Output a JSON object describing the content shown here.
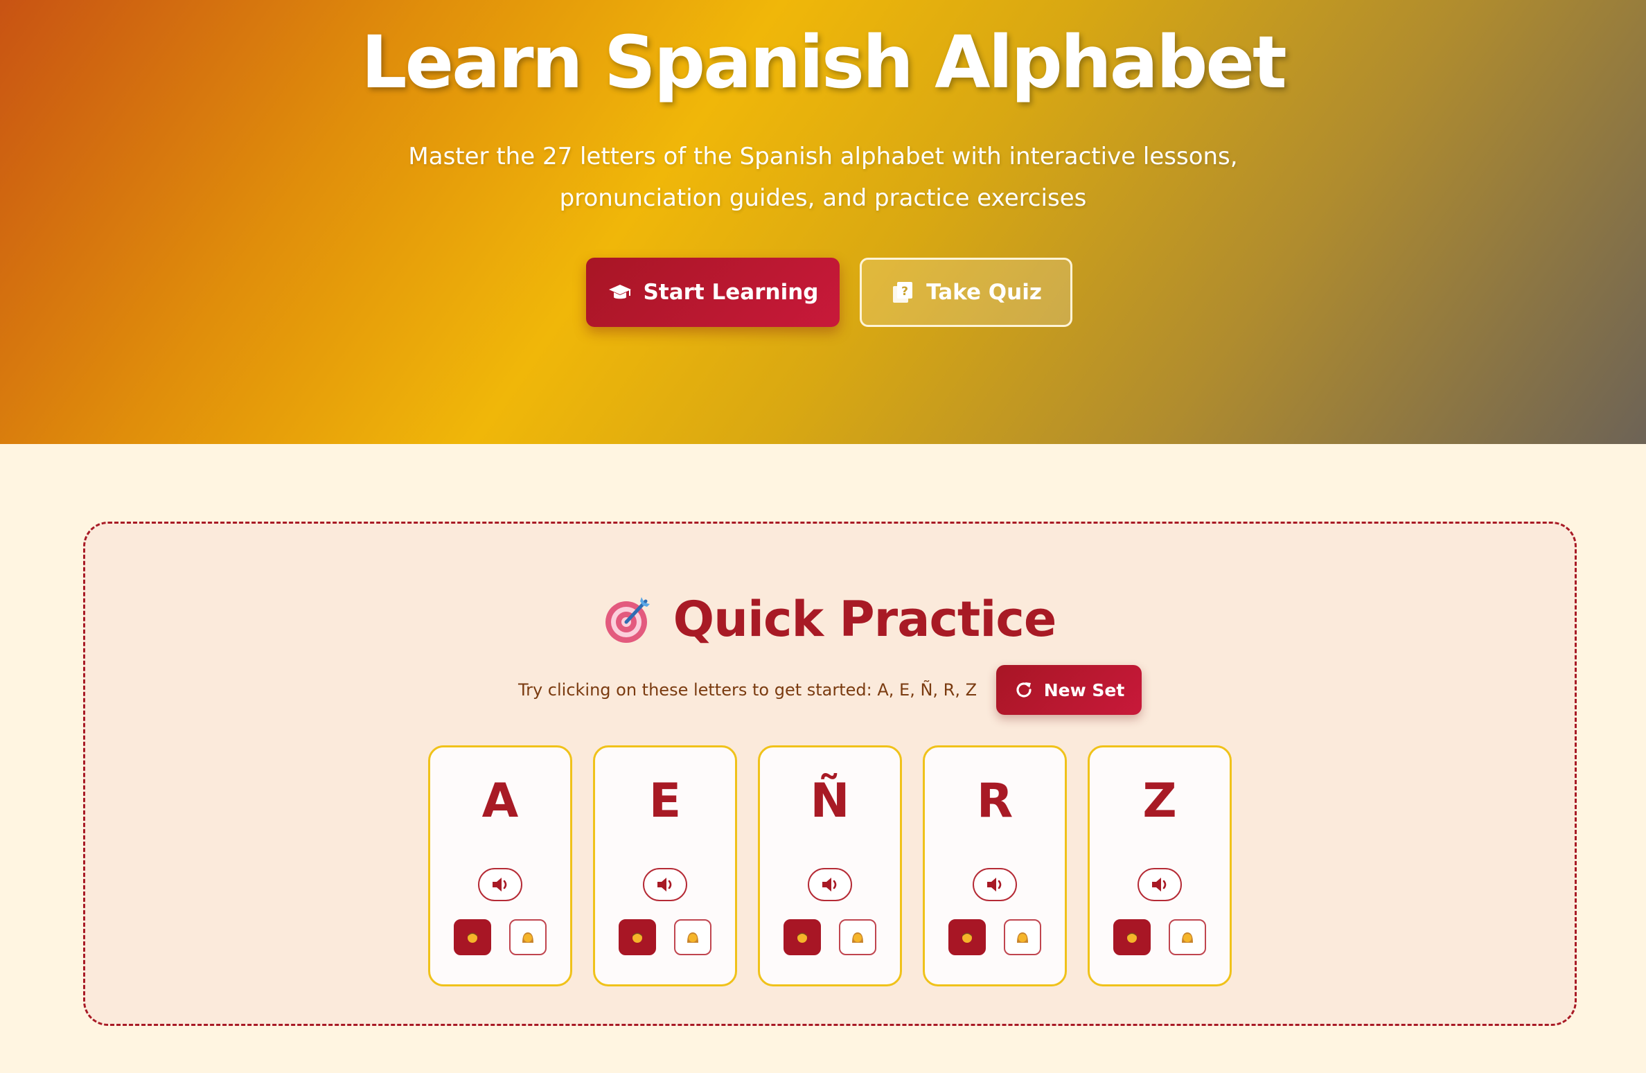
{
  "hero": {
    "title": "Learn Spanish Alphabet",
    "subtitle": "Master the 27 letters of the Spanish alphabet with interactive lessons, pronunciation guides, and practice exercises",
    "primary_button": {
      "label": "Start Learning",
      "icon": "graduation-cap-icon"
    },
    "secondary_button": {
      "label": "Take Quiz",
      "icon": "quiz-icon"
    }
  },
  "practice": {
    "title": "Quick Practice",
    "title_icon": "target-icon",
    "hint": "Try clicking on these letters to get started: A, E, Ñ, R, Z",
    "new_set_button": {
      "label": "New Set",
      "icon": "refresh-icon"
    },
    "cards": [
      {
        "letter": "A"
      },
      {
        "letter": "E"
      },
      {
        "letter": "Ñ"
      },
      {
        "letter": "R"
      },
      {
        "letter": "Z"
      }
    ]
  },
  "colors": {
    "accent_red": "#a81a25",
    "card_border": "#f0c21a",
    "panel_bg": "#fbeadb",
    "page_bg": "#fff5e1"
  }
}
